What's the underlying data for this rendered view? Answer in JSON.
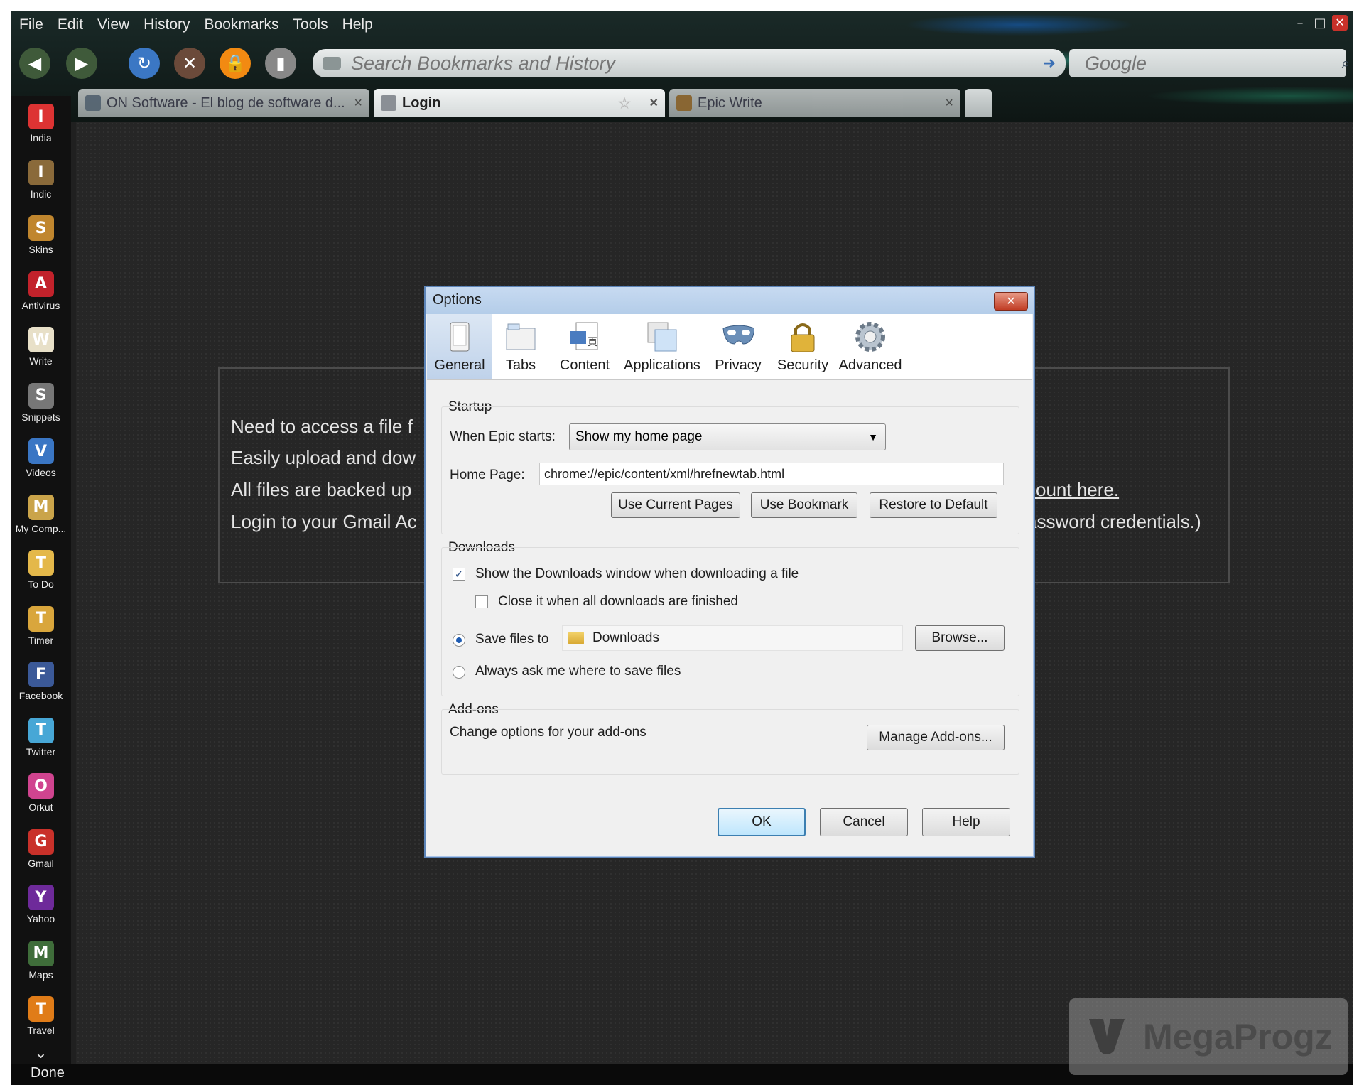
{
  "menubar": [
    "File",
    "Edit",
    "View",
    "History",
    "Bookmarks",
    "Tools",
    "Help"
  ],
  "toolbar": {
    "url_placeholder": "Search Bookmarks and History",
    "search_placeholder": "Google"
  },
  "tabs": [
    {
      "label": "ON Software - El blog de software d...",
      "active": false
    },
    {
      "label": "Login",
      "active": true
    },
    {
      "label": "Epic Write",
      "active": false
    }
  ],
  "sidebar": [
    {
      "label": "India",
      "icon": "india-icon",
      "color": "#d33"
    },
    {
      "label": "Indic",
      "icon": "indic-icon",
      "color": "#8a6a3a"
    },
    {
      "label": "Skins",
      "icon": "skins-icon",
      "color": "#c0862e"
    },
    {
      "label": "Antivirus",
      "icon": "antivirus-icon",
      "color": "#c2222b"
    },
    {
      "label": "Write",
      "icon": "write-icon",
      "color": "#e8e0c8"
    },
    {
      "label": "Snippets",
      "icon": "snippets-icon",
      "color": "#777"
    },
    {
      "label": "Videos",
      "icon": "videos-icon",
      "color": "#3a76c4"
    },
    {
      "label": "My Comp...",
      "icon": "my-computer-icon",
      "color": "#caa44a"
    },
    {
      "label": "To Do",
      "icon": "todo-icon",
      "color": "#e4b84a"
    },
    {
      "label": "Timer",
      "icon": "timer-icon",
      "color": "#d9a63c"
    },
    {
      "label": "Facebook",
      "icon": "facebook-icon",
      "color": "#3b5998"
    },
    {
      "label": "Twitter",
      "icon": "twitter-icon",
      "color": "#47a7d6"
    },
    {
      "label": "Orkut",
      "icon": "orkut-icon",
      "color": "#d0448f"
    },
    {
      "label": "Gmail",
      "icon": "gmail-icon",
      "color": "#c9312a"
    },
    {
      "label": "Yahoo",
      "icon": "yahoo-icon",
      "color": "#6e2a9a"
    },
    {
      "label": "Maps",
      "icon": "maps-icon",
      "color": "#3f6d3a"
    },
    {
      "label": "Travel",
      "icon": "travel-icon",
      "color": "#e07c18"
    }
  ],
  "page": {
    "lines": [
      "Need to access a file f",
      "Easily upload and dow",
      "All files are backed up",
      "Login to your Gmail Ac"
    ],
    "right_link": "count here.",
    "right_text": "assword credentials.)"
  },
  "status": "Done",
  "watermark": "MegaProgz",
  "dialog": {
    "title": "Options",
    "tabs": [
      "General",
      "Tabs",
      "Content",
      "Applications",
      "Privacy",
      "Security",
      "Advanced"
    ],
    "startup": {
      "title": "Startup",
      "when_label": "When Epic starts:",
      "when_value": "Show my home page",
      "home_label": "Home Page:",
      "home_value": "chrome://epic/content/xml/hrefnewtab.html",
      "btn_current": "Use Current Pages",
      "btn_bookmark": "Use Bookmark",
      "btn_restore": "Restore to Default"
    },
    "downloads": {
      "title": "Downloads",
      "show_window": "Show the Downloads window when downloading a file",
      "close_when_done": "Close it when all downloads are finished",
      "save_to": "Save files to",
      "folder": "Downloads",
      "browse": "Browse...",
      "always_ask": "Always ask me where to save files",
      "show_window_checked": true,
      "close_checked": false
    },
    "addons": {
      "title": "Add-ons",
      "desc": "Change options for your add-ons",
      "manage": "Manage Add-ons..."
    },
    "ok": "OK",
    "cancel": "Cancel",
    "help": "Help"
  }
}
